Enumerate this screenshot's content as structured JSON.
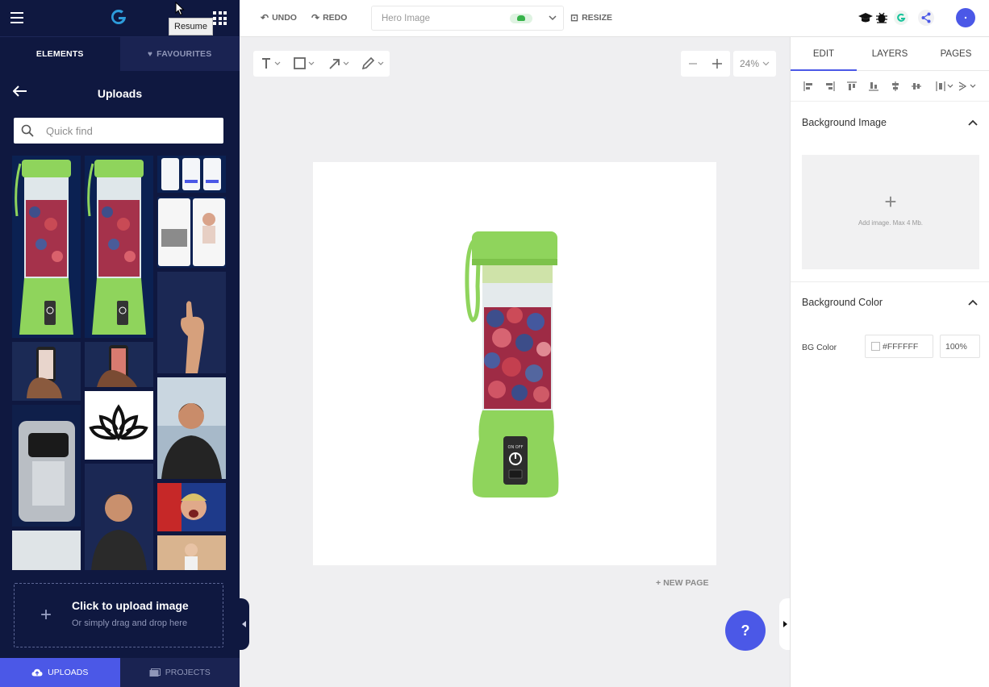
{
  "tooltip": "Resume",
  "left_tabs": {
    "elements": "ELEMENTS",
    "favourites": "FAVOURITES"
  },
  "uploads": {
    "title": "Uploads",
    "search_placeholder": "Quick find",
    "upload_title": "Click to upload image",
    "upload_sub": "Or simply drag and drop here"
  },
  "bottom_tabs": {
    "uploads": "UPLOADS",
    "projects": "PROJECTS"
  },
  "toolbar": {
    "undo": "UNDO",
    "redo": "REDO",
    "doc_name": "Hero Image",
    "resize": "RESIZE"
  },
  "canvas": {
    "zoom": "24%",
    "new_page": "NEW PAGE",
    "help": "?",
    "blender_label": "ON OFF"
  },
  "right_panel": {
    "tabs": {
      "edit": "EDIT",
      "layers": "LAYERS",
      "pages": "PAGES"
    },
    "bg_image_title": "Background Image",
    "bg_image_hint": "Add image. Max 4 Mb.",
    "bg_color_title": "Background Color",
    "bg_color_label": "BG Color",
    "bg_color_value": "#FFFFFF",
    "bg_opacity": "100%"
  },
  "colors": {
    "accent": "#4b58e7",
    "sidebar_bg": "#0f1840",
    "blender_green": "#8fd45c"
  }
}
